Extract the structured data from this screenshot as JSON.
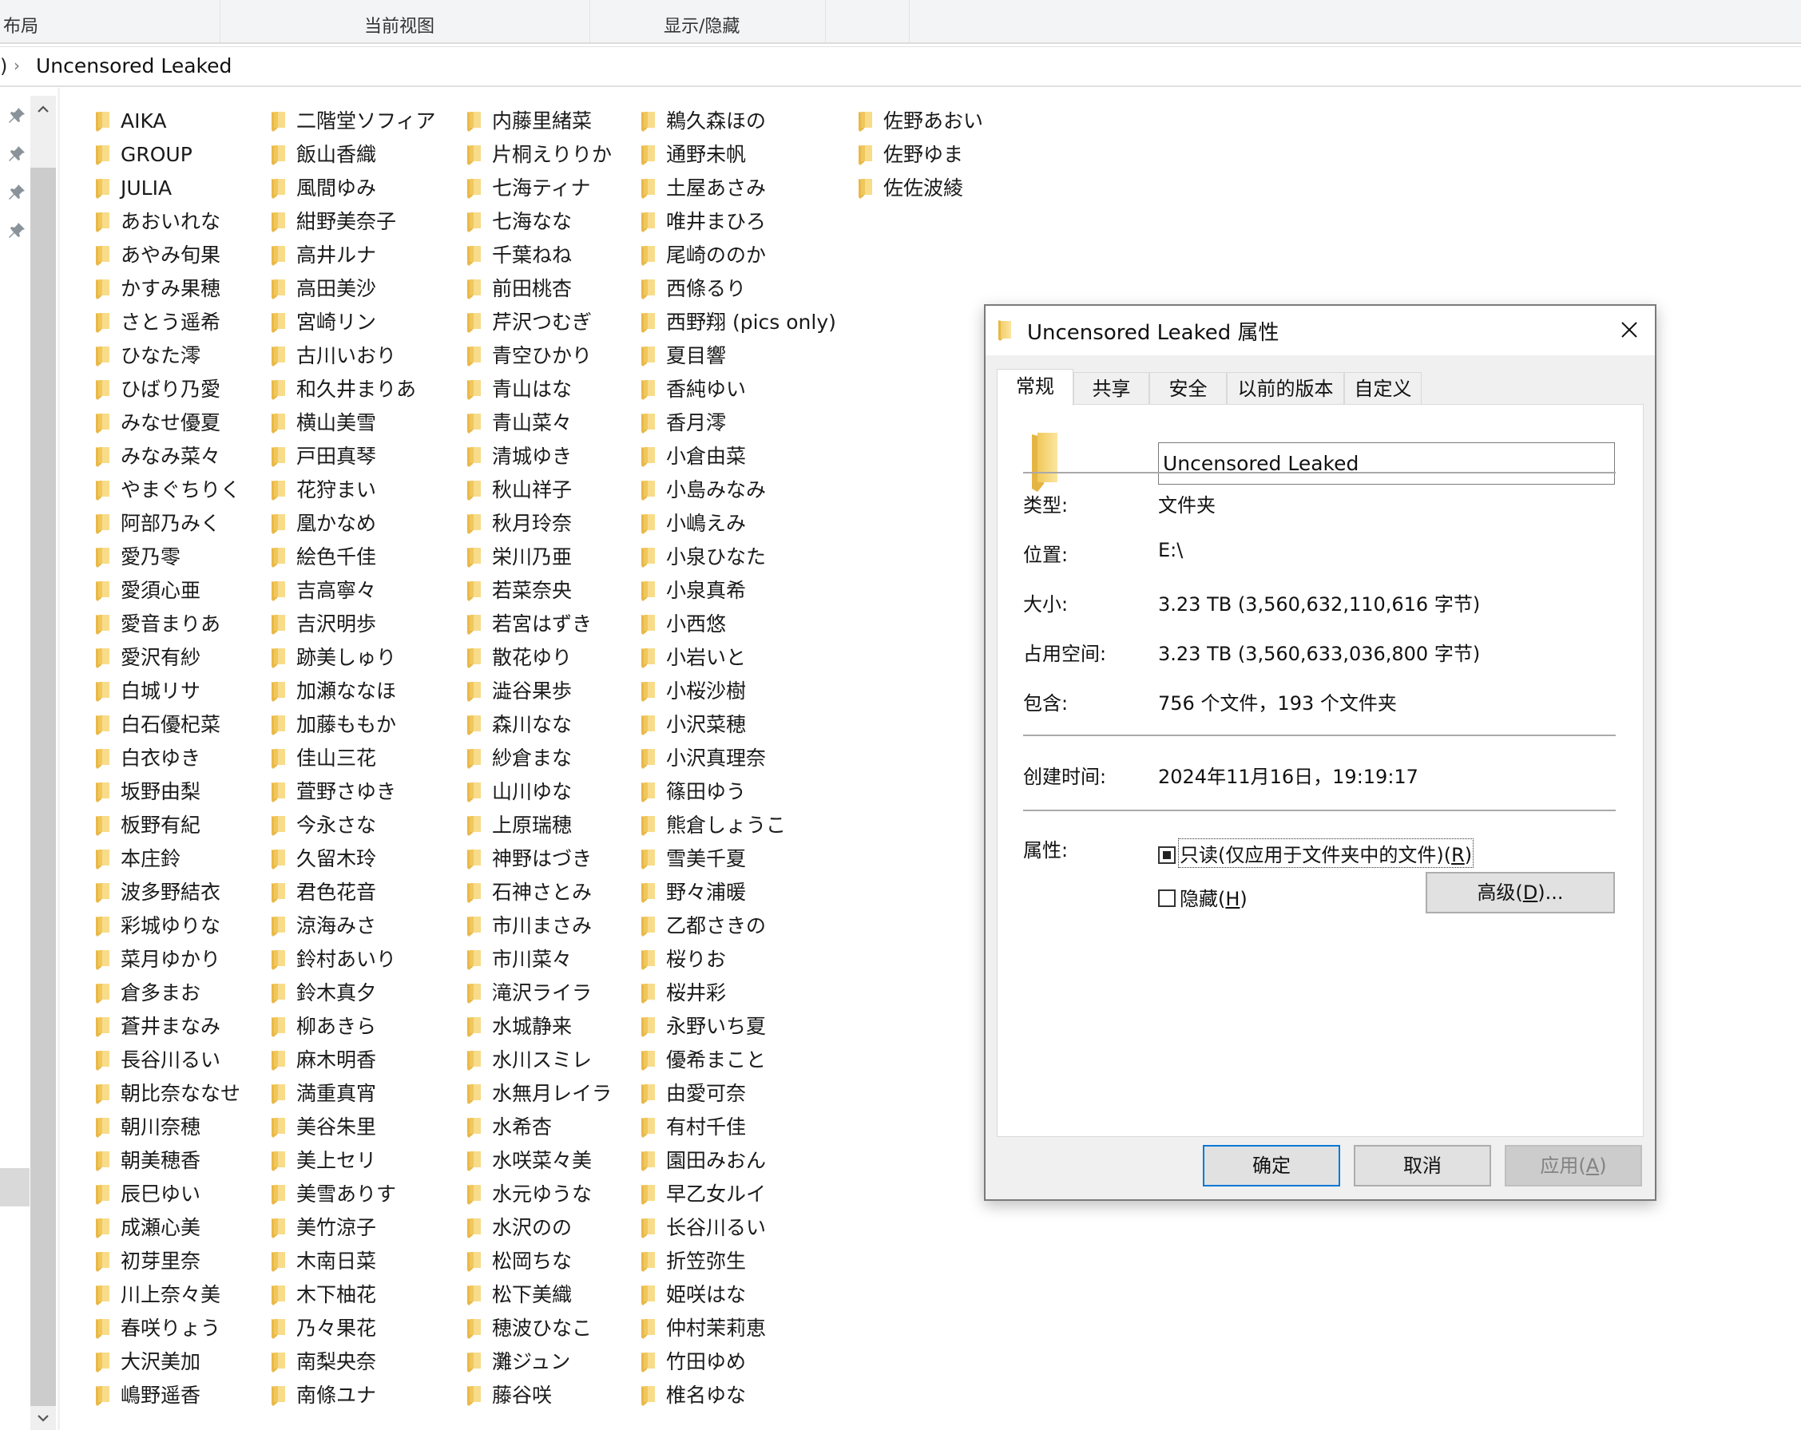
{
  "ribbon": {
    "groups": [
      "布局",
      "当前视图",
      "显示/隐藏"
    ]
  },
  "address_bar": {
    "truncated_prefix": ")",
    "separator_icon": "chevron-right-icon",
    "current": "Uncensored Leaked"
  },
  "nav_pane": {
    "pinned_icons": [
      "pin-icon",
      "pin-icon",
      "pin-icon",
      "pin-icon"
    ]
  },
  "folders": {
    "columns": [
      [
        "AIKA",
        "GROUP",
        "JULIA",
        "あおいれな",
        "あやみ旬果",
        "かすみ果穂",
        "さとう遥希",
        "ひなた澪",
        "ひばり乃愛",
        "みなせ優夏",
        "みなみ菜々",
        "やまぐちりく",
        "阿部乃みく",
        "愛乃零",
        "愛須心亜",
        "愛音まりあ",
        "愛沢有紗",
        "白城リサ",
        "白石優杞菜",
        "白衣ゆき",
        "坂野由梨",
        "板野有紀",
        "本庄鈴",
        "波多野結衣",
        "彩城ゆりな",
        "菜月ゆかり",
        "倉多まお",
        "蒼井まなみ",
        "長谷川るい",
        "朝比奈ななせ",
        "朝川奈穂",
        "朝美穂香",
        "辰巳ゆい",
        "成瀬心美",
        "初芽里奈",
        "川上奈々美",
        "春咲りょう",
        "大沢美加",
        "嶋野遥香"
      ],
      [
        "二階堂ソフィア",
        "飯山香織",
        "風間ゆみ",
        "紺野美奈子",
        "高井ルナ",
        "高田美沙",
        "宮崎リン",
        "古川いおり",
        "和久井まりあ",
        "横山美雪",
        "戸田真琴",
        "花狩まい",
        "凰かなめ",
        "絵色千佳",
        "吉高寧々",
        "吉沢明歩",
        "跡美しゅり",
        "加瀬ななほ",
        "加藤ももか",
        "佳山三花",
        "萓野さゆき",
        "今永さな",
        "久留木玲",
        "君色花音",
        "涼海みさ",
        "鈴村あいり",
        "鈴木真夕",
        "柳あきら",
        "麻木明香",
        "満重真宵",
        "美谷朱里",
        "美上セリ",
        "美雪ありす",
        "美竹涼子",
        "木南日菜",
        "木下柚花",
        "乃々果花",
        "南梨央奈",
        "南條ユナ"
      ],
      [
        "内藤里緒菜",
        "片桐えりりか",
        "七海ティナ",
        "七海なな",
        "千葉ねね",
        "前田桃杏",
        "芹沢つむぎ",
        "青空ひかり",
        "青山はな",
        "青山菜々",
        "清城ゆき",
        "秋山祥子",
        "秋月玲奈",
        "栄川乃亜",
        "若菜奈央",
        "若宮はずき",
        "散花ゆり",
        "澁谷果歩",
        "森川なな",
        "紗倉まな",
        "山川ゆな",
        "上原瑞穂",
        "神野はづき",
        "石神さとみ",
        "市川まさみ",
        "市川菜々",
        "滝沢ライラ",
        "水城静来",
        "水川スミレ",
        "水無月レイラ",
        "水希杏",
        "水咲菜々美",
        "水元ゆうな",
        "水沢のの",
        "松岡ちな",
        "松下美織",
        "穂波ひなこ",
        "灘ジュン",
        "藤谷咲"
      ],
      [
        "鵜久森ほの",
        "通野未帆",
        "土屋あさみ",
        "唯井まひろ",
        "尾崎ののか",
        "西條るり",
        "西野翔 (pics only)",
        "夏目響",
        "香純ゆい",
        "香月澪",
        "小倉由菜",
        "小島みなみ",
        "小嶋えみ",
        "小泉ひなた",
        "小泉真希",
        "小西悠",
        "小岩いと",
        "小桜沙樹",
        "小沢菜穂",
        "小沢真理奈",
        "篠田ゆう",
        "熊倉しょうこ",
        "雪美千夏",
        "野々浦暖",
        "乙都さきの",
        "桜りお",
        "桜井彩",
        "永野いち夏",
        "優希まこと",
        "由愛可奈",
        "有村千佳",
        "園田みおん",
        "早乙女ルイ",
        "长谷川るい",
        "折笠弥生",
        "姫咲はな",
        "仲村茉莉恵",
        "竹田ゆめ",
        "椎名ゆな"
      ],
      [
        "佐野あおい",
        "佐野ゆま",
        "佐佐波綾"
      ]
    ]
  },
  "dialog": {
    "title": "Uncensored Leaked 属性",
    "close_icon": "close-icon",
    "tabs": [
      "常规",
      "共享",
      "安全",
      "以前的版本",
      "自定义"
    ],
    "active_tab": "常规",
    "name_value": "Uncensored Leaked",
    "properties": [
      {
        "label": "类型:",
        "value": "文件夹"
      },
      {
        "label": "位置:",
        "value": "E:\\"
      },
      {
        "label": "大小:",
        "value": "3.23 TB (3,560,632,110,616 字节)"
      },
      {
        "label": "占用空间:",
        "value": "3.23 TB (3,560,633,036,800 字节)"
      },
      {
        "label": "包含:",
        "value": "756 个文件，193 个文件夹"
      }
    ],
    "created": {
      "label": "创建时间:",
      "value": "2024年11月16日，19:19:17"
    },
    "attributes": {
      "label": "属性:",
      "readonly": {
        "text": "只读(仅应用于文件夹中的文件)(",
        "accel": "R",
        "tail": ")",
        "state": "indeterminate"
      },
      "hidden": {
        "text": "隐藏(",
        "accel": "H",
        "tail": ")",
        "state": "unchecked"
      },
      "advanced": {
        "text": "高级(",
        "accel": "D",
        "tail": ")..."
      }
    },
    "buttons": {
      "ok": "确定",
      "cancel": "取消",
      "apply": {
        "text": "应用(",
        "accel": "A",
        "tail": ")",
        "enabled": false
      }
    }
  }
}
